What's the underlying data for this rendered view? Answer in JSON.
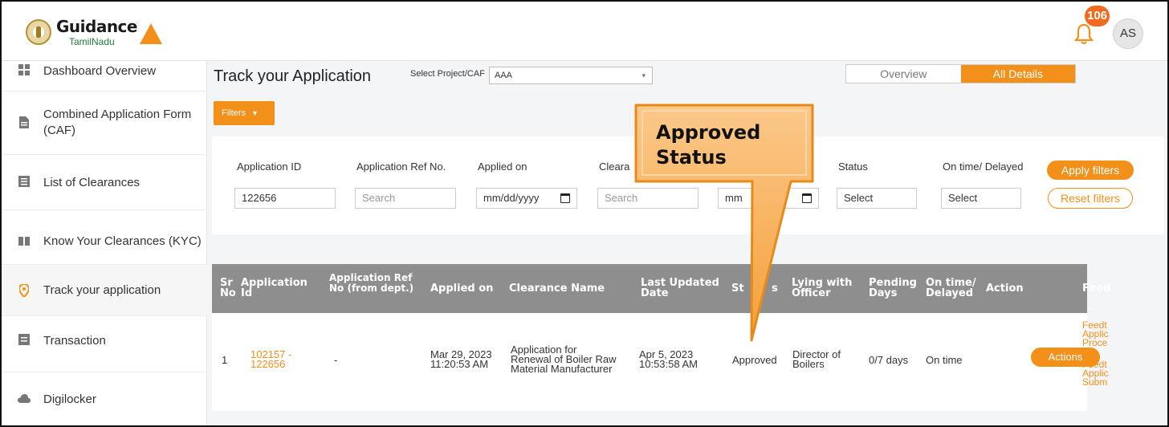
{
  "brand": {
    "name": "Guidance",
    "sub": "TamilNadu"
  },
  "header": {
    "notifications": "106",
    "avatar": "AS"
  },
  "sidebar": {
    "items": [
      {
        "label": "Dashboard Overview",
        "icon": "grid-icon"
      },
      {
        "label": "Combined Application Form (CAF)",
        "icon": "document-icon"
      },
      {
        "label": "List of Clearances",
        "icon": "list-icon"
      },
      {
        "label": "Know Your Clearances (KYC)",
        "icon": "book-icon"
      },
      {
        "label": "Track your application",
        "icon": "location-pin-icon"
      },
      {
        "label": "Transaction",
        "icon": "receipt-icon"
      },
      {
        "label": "Digilocker",
        "icon": "cloud-icon"
      }
    ]
  },
  "main": {
    "title": "Track your Application",
    "project_label": "Select Project/CAF",
    "project_value": "AAA",
    "tabs": {
      "overview": "Overview",
      "all_details": "All Details"
    },
    "filters_label": "Filters"
  },
  "filters": {
    "application_id": {
      "label": "Application ID",
      "value": "122656"
    },
    "application_ref": {
      "label": "Application Ref No.",
      "placeholder": "Search"
    },
    "applied_on": {
      "label": "Applied on",
      "placeholder": "mm/dd/yyyy"
    },
    "clearance_name": {
      "label": "Cleara",
      "placeholder": "Search"
    },
    "last_updated": {
      "placeholder": "mm"
    },
    "status": {
      "label": "Status",
      "placeholder": "Select"
    },
    "on_time": {
      "label": "On time/ Delayed",
      "placeholder": "Select"
    },
    "apply_label": "Apply filters",
    "reset_label": "Reset filters"
  },
  "table": {
    "columns": [
      "Sr No",
      "Application Id",
      "Application Ref No (from dept.)",
      "Applied on",
      "Clearance Name",
      "Last Updated Date",
      "St",
      "s",
      "Lying with Officer",
      "Pending Days",
      "On time/ Delayed",
      "Action",
      "Feed"
    ],
    "rows": [
      {
        "sr": "1",
        "app_id_1": "102157 -",
        "app_id_2": "122656",
        "ref": "-",
        "applied_1": "Mar 29, 2023",
        "applied_2": "11:20:53 AM",
        "clearance_1": "Application for",
        "clearance_2": "Renewal of Boiler Raw",
        "clearance_3": "Material Manufacturer",
        "updated_1": "Apr 5, 2023",
        "updated_2": "10:53:58 AM",
        "status": "Approved",
        "officer_1": "Director of",
        "officer_2": "Boilers",
        "pending": "0/7 days",
        "ontime": "On time",
        "action": "Actions",
        "feedback": [
          "Feedt",
          "Applic",
          "Proce",
          "Feedt",
          "Applic",
          "Subm"
        ]
      }
    ]
  },
  "callout": {
    "line1": "Approved",
    "line2": "Status",
    "color": "#f39019"
  },
  "colors": {
    "accent": "#f39019",
    "header_bg": "#8e8e8e"
  }
}
